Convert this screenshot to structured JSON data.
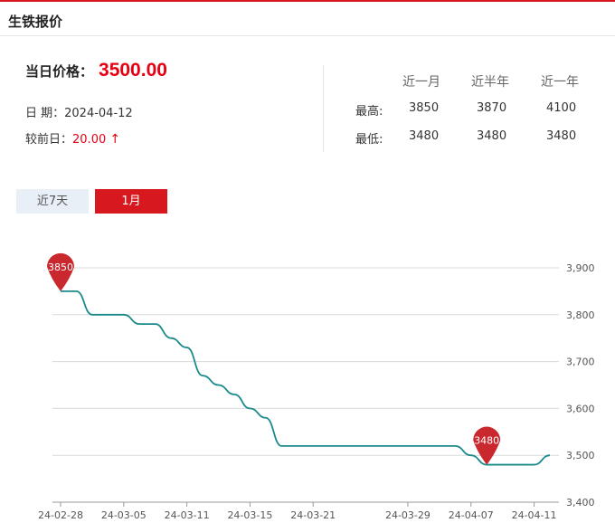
{
  "header": {
    "title": "生铁报价"
  },
  "price": {
    "label": "当日价格：",
    "value": "3500.00"
  },
  "date": {
    "label": "日  期：",
    "value": "2024-04-12"
  },
  "change": {
    "label": "较前日：",
    "value": "20.00",
    "arrow": "↑"
  },
  "stats": {
    "columns": [
      "近一月",
      "近半年",
      "近一年"
    ],
    "rows": [
      {
        "label": "最高:",
        "values": [
          "3850",
          "3870",
          "4100"
        ]
      },
      {
        "label": "最低:",
        "values": [
          "3480",
          "3480",
          "3480"
        ]
      }
    ]
  },
  "tabs": [
    {
      "label": "近7天",
      "active": false
    },
    {
      "label": "1月",
      "active": true
    }
  ],
  "colors": {
    "accent": "#d7191f",
    "line": "#1a8a8a",
    "up": "#e60012",
    "tab_inactive": "#e8eff7"
  },
  "chart_data": {
    "type": "line",
    "x": [
      "24-02-28",
      "24-02-29",
      "24-03-01",
      "24-03-04",
      "24-03-05",
      "24-03-06",
      "24-03-07",
      "24-03-08",
      "24-03-11",
      "24-03-12",
      "24-03-13",
      "24-03-14",
      "24-03-15",
      "24-03-18",
      "24-03-19",
      "24-03-20",
      "24-03-21",
      "24-03-22",
      "24-03-25",
      "24-03-26",
      "24-03-27",
      "24-03-28",
      "24-03-29",
      "24-04-01",
      "24-04-02",
      "24-04-03",
      "24-04-07",
      "24-04-08",
      "24-04-09",
      "24-04-10",
      "24-04-11",
      "24-04-12"
    ],
    "series": [
      {
        "values": [
          3850,
          3850,
          3800,
          3800,
          3800,
          3780,
          3780,
          3750,
          3730,
          3670,
          3650,
          3630,
          3600,
          3580,
          3520,
          3520,
          3520,
          3520,
          3520,
          3520,
          3520,
          3520,
          3520,
          3520,
          3520,
          3520,
          3500,
          3480,
          3480,
          3480,
          3480,
          3500
        ]
      }
    ],
    "tick_labels": [
      "24-02-28",
      "24-03-05",
      "24-03-11",
      "24-03-15",
      "24-03-21",
      "24-03-29",
      "24-04-07",
      "24-04-11"
    ],
    "y_ticks": [
      "3,900",
      "3,800",
      "3,700",
      "3,600",
      "3,500",
      "3,400"
    ],
    "ylim": [
      3400,
      3900
    ],
    "markers": [
      {
        "label": "3850",
        "index": 0,
        "value": 3850
      },
      {
        "label": "3480",
        "index": 27,
        "value": 3480
      }
    ],
    "grid": true,
    "y_axis_position": "right"
  }
}
